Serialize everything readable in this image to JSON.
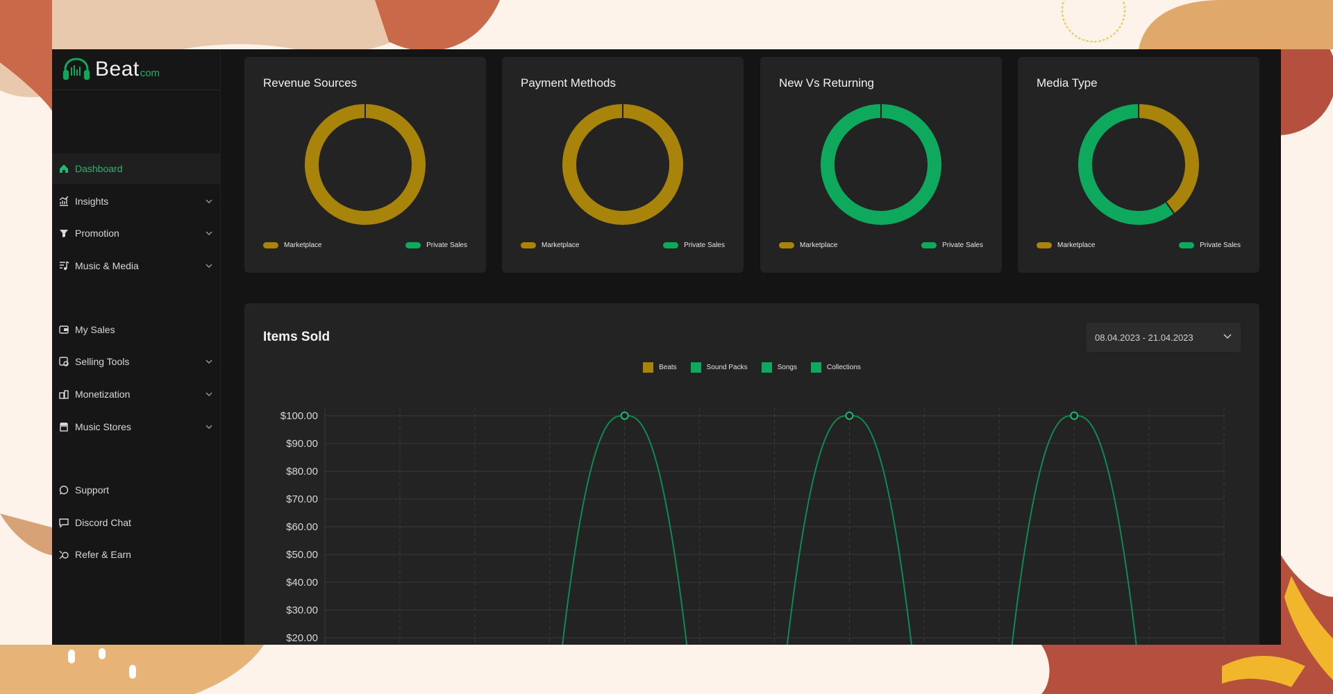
{
  "app": {
    "logo_text": "Beat",
    "logo_suffix": "com"
  },
  "colors": {
    "accent_green": "#0fa95e",
    "gold": "#a8840a",
    "sidebar_bg": "#161616",
    "card_bg": "#232323"
  },
  "sidebar": {
    "items": [
      {
        "label": "Dashboard",
        "icon": "home-icon",
        "active": true,
        "chevron": false
      },
      {
        "label": "Insights",
        "icon": "insights-chart-icon",
        "active": false,
        "chevron": true
      },
      {
        "label": "Promotion",
        "icon": "promotion-icon",
        "active": false,
        "chevron": true
      },
      {
        "label": "Music & Media",
        "icon": "music-media-icon",
        "active": false,
        "chevron": true
      },
      {
        "label": "My Sales",
        "icon": "wallet-icon",
        "active": false,
        "chevron": false
      },
      {
        "label": "Selling Tools",
        "icon": "selling-tools-icon",
        "active": false,
        "chevron": true
      },
      {
        "label": "Monetization",
        "icon": "monetization-icon",
        "active": false,
        "chevron": true
      },
      {
        "label": "Music Stores",
        "icon": "store-icon",
        "active": false,
        "chevron": true
      },
      {
        "label": "Support",
        "icon": "support-icon",
        "active": false,
        "chevron": false
      },
      {
        "label": "Discord Chat",
        "icon": "chat-icon",
        "active": false,
        "chevron": false
      },
      {
        "label": "Refer & Earn",
        "icon": "refer-icon",
        "active": false,
        "chevron": false
      }
    ]
  },
  "donut_cards": [
    {
      "title": "Revenue Sources",
      "legend": [
        "Marketplace",
        "Private Sales"
      ],
      "values": [
        1.0,
        0.0
      ]
    },
    {
      "title": "Payment Methods",
      "legend": [
        "Marketplace",
        "Private Sales"
      ],
      "values": [
        1.0,
        0.0
      ]
    },
    {
      "title": "New Vs Returning",
      "legend": [
        "Marketplace",
        "Private Sales"
      ],
      "values": [
        0.0,
        1.0
      ]
    },
    {
      "title": "Media Type",
      "legend": [
        "Marketplace",
        "Private Sales"
      ],
      "values": [
        0.4,
        0.6
      ]
    }
  ],
  "items_sold": {
    "title": "Items Sold",
    "date_range": "08.04.2023 - 21.04.2023",
    "legend": [
      {
        "name": "Beats",
        "color": "#a8840a"
      },
      {
        "name": "Sound Packs",
        "color": "#0fa95e"
      },
      {
        "name": "Songs",
        "color": "#0fa95e"
      },
      {
        "name": "Collections",
        "color": "#0fa95e"
      }
    ]
  },
  "chart_data": {
    "type": "line",
    "y_tick_labels": [
      "$100.00",
      "$90.00",
      "$80.00",
      "$70.00",
      "$60.00",
      "$50.00",
      "$40.00",
      "$30.00",
      "$20.00"
    ],
    "ylim": [
      20,
      100
    ],
    "x_count": 14,
    "series": [
      {
        "values": [
          0,
          0,
          0,
          0,
          100,
          0,
          0,
          100,
          0,
          0,
          100,
          0,
          0,
          0
        ]
      }
    ],
    "grid": true
  }
}
